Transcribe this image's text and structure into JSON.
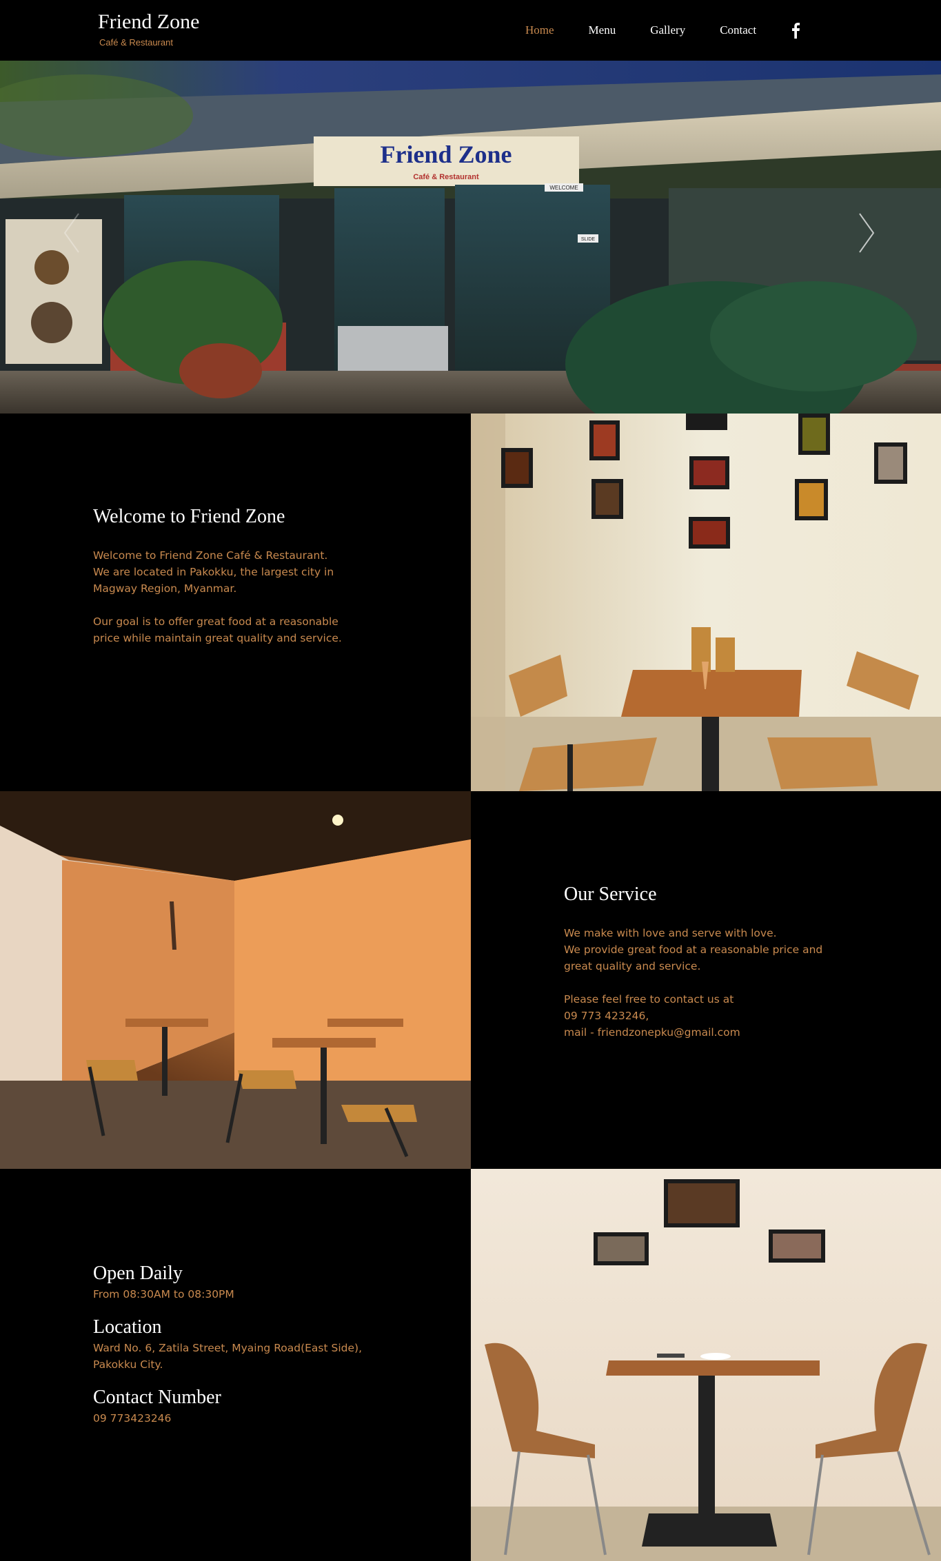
{
  "brand": {
    "title": "Friend Zone",
    "subtitle": "Café & Restaurant"
  },
  "nav": {
    "items": [
      "Home",
      "Menu",
      "Gallery",
      "Contact"
    ],
    "active": 0
  },
  "hero": {
    "sign_text": "Friend Zone",
    "sign_sub": "Café & Restaurant",
    "welcome_sign": "WELCOME",
    "slide_sign": "SLIDE"
  },
  "welcome": {
    "heading": "Welcome to Friend Zone",
    "lines": [
      "Welcome to Friend Zone Café & Restaurant.",
      "We are located in Pakokku, the largest city in",
      "Magway Region, Myanmar."
    ],
    "goal_lines": [
      "Our goal is to offer great food at a reasonable",
      "price while maintain great quality and service."
    ]
  },
  "service": {
    "heading": "Our Service",
    "lines": [
      "We make with love and serve with love.",
      "We provide great food at a reasonable price and",
      "great quality and service."
    ],
    "contact_lines": [
      "Please feel free to contact us at",
      "09 773 423246,",
      "mail - friendzonepku@gmail.com"
    ]
  },
  "info": {
    "open_heading": "Open Daily",
    "open_hours": "From 08:30AM to 08:30PM",
    "location_heading": "Location",
    "location_lines": [
      "Ward No. 6, Zatila Street, Myaing Road(East Side),",
      "Pakokku City."
    ],
    "contact_heading": "Contact Number",
    "contact_number": "09 773423246"
  },
  "colors": {
    "accent": "#c98a4f",
    "background": "#000000",
    "text": "#ffffff"
  },
  "icons": {
    "social": "facebook-icon",
    "next": "chevron-right-icon",
    "prev": "chevron-left-icon"
  }
}
